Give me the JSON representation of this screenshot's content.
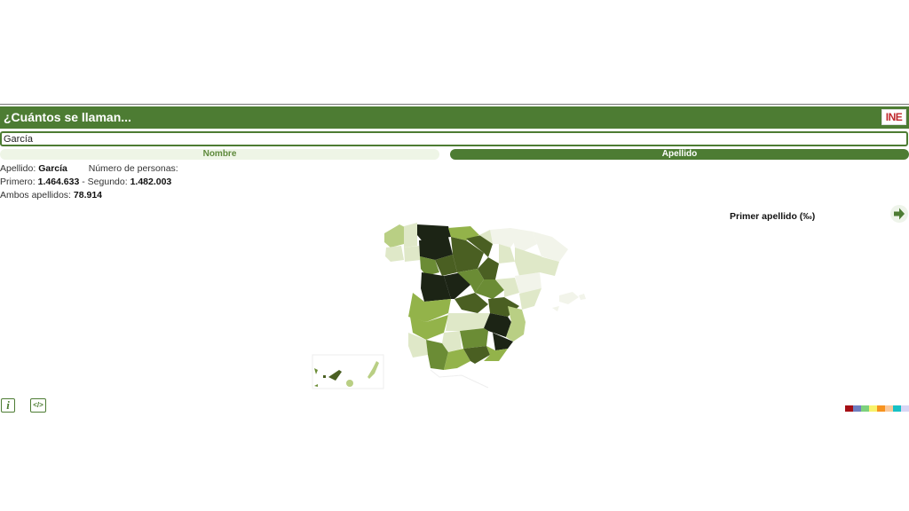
{
  "header": {
    "title": "¿Cuántos se llaman...",
    "logo": "INE"
  },
  "search": {
    "value": "García",
    "placeholder": ""
  },
  "tabs": [
    {
      "label": "Nombre",
      "active": false
    },
    {
      "label": "Apellido",
      "active": true
    }
  ],
  "info": {
    "apellido_label": "Apellido:",
    "apellido_value": "García",
    "personas_label": "Número de personas:",
    "primero_label": "Primero:",
    "primero_value": "1.464.633",
    "separator": "-",
    "segundo_label": "Segundo:",
    "segundo_value": "1.482.003",
    "ambos_label": "Ambos apellidos:",
    "ambos_value": "78.914"
  },
  "map": {
    "title": "Primer apellido (‰)",
    "next_icon": "arrow-right-icon",
    "scale_colors": [
      "#f2f4ea",
      "#dfe8c8",
      "#b9cf84",
      "#93b34a",
      "#6b8c35",
      "#4a5f22",
      "#1c2415"
    ]
  },
  "footer": {
    "info_icon": "info-icon",
    "info_glyph": "i",
    "embed_icon": "code-icon",
    "embed_glyph": "</>",
    "palette": [
      "#a50f15",
      "#6f7fc0",
      "#7dd17d",
      "#f8f36b",
      "#f7931e",
      "#f9c89b",
      "#17c1c6",
      "#d8d6f5"
    ]
  }
}
